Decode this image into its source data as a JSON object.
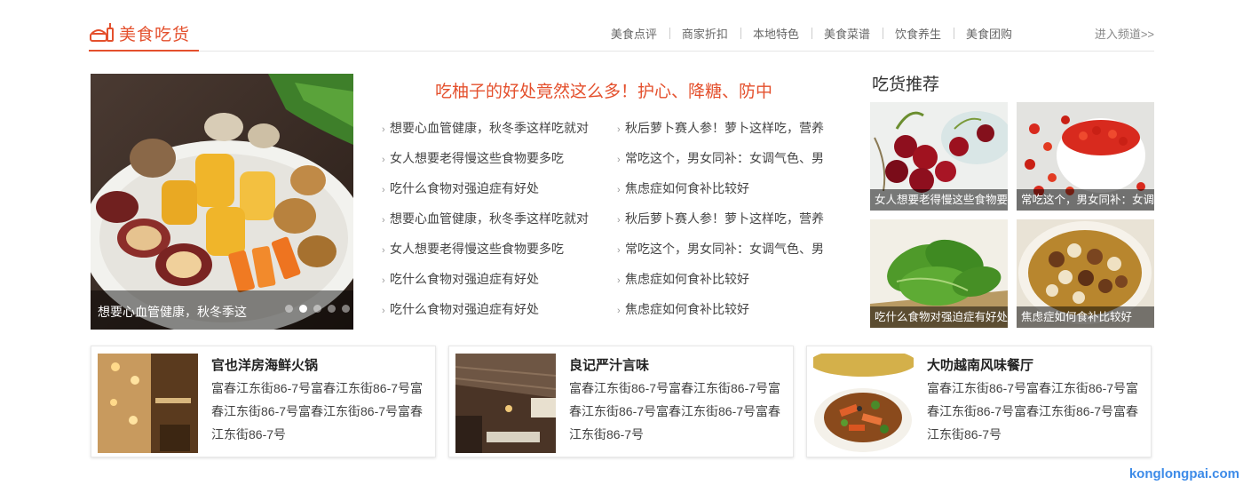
{
  "brand": {
    "title": "美食吃货",
    "accent": "#e4502d"
  },
  "nav": {
    "items": [
      "美食点评",
      "商家折扣",
      "本地特色",
      "美食菜谱",
      "饮食养生",
      "美食团购"
    ],
    "enter": "进入频道>>"
  },
  "slide": {
    "caption": "想要心血管健康，秋冬季这",
    "dots": 5,
    "active_dot": 1
  },
  "headline": "吃柚子的好处竟然这么多！护心、降糖、防中",
  "news_left": [
    "想要心血管健康，秋冬季这样吃就对",
    "女人想要老得慢这些食物要多吃",
    "吃什么食物对强迫症有好处",
    "想要心血管健康，秋冬季这样吃就对",
    "女人想要老得慢这些食物要多吃",
    "吃什么食物对强迫症有好处",
    "吃什么食物对强迫症有好处"
  ],
  "news_right": [
    "秋后萝卜赛人参！萝卜这样吃，营养",
    "常吃这个，男女同补：女调气色、男",
    "焦虑症如何食补比较好",
    "秋后萝卜赛人参！萝卜这样吃，营养",
    "常吃这个，男女同补：女调气色、男",
    "焦虑症如何食补比较好",
    "焦虑症如何食补比较好"
  ],
  "recommend": {
    "title": "吃货推荐",
    "cards": [
      {
        "caption": "女人想要老得慢这些食物要",
        "image": "cherries"
      },
      {
        "caption": "常吃这个，男女同补：女调",
        "image": "goji-berries"
      },
      {
        "caption": "吃什么食物对强迫症有好处",
        "image": "spinach"
      },
      {
        "caption": "焦虑症如何食补比较好",
        "image": "dessert-bowl"
      }
    ]
  },
  "shops": [
    {
      "name": "官也洋房海鲜火锅",
      "address": "富春江东街86-7号富春江东街86-7号富春江东街86-7号富春江东街86-7号富春江东街86-7号",
      "image": "restaurant-interior"
    },
    {
      "name": "良记严汁言味",
      "address": "富春江东街86-7号富春江东街86-7号富春江东街86-7号富春江东街86-7号富春江东街86-7号",
      "image": "food-court"
    },
    {
      "name": "大叻越南风味餐厅",
      "address": "富春江东街86-7号富春江东街86-7号富春江东街86-7号富春江东街86-7号富春江东街86-7号",
      "image": "stir-fry-dish"
    }
  ],
  "watermark": "konglongpai.com"
}
